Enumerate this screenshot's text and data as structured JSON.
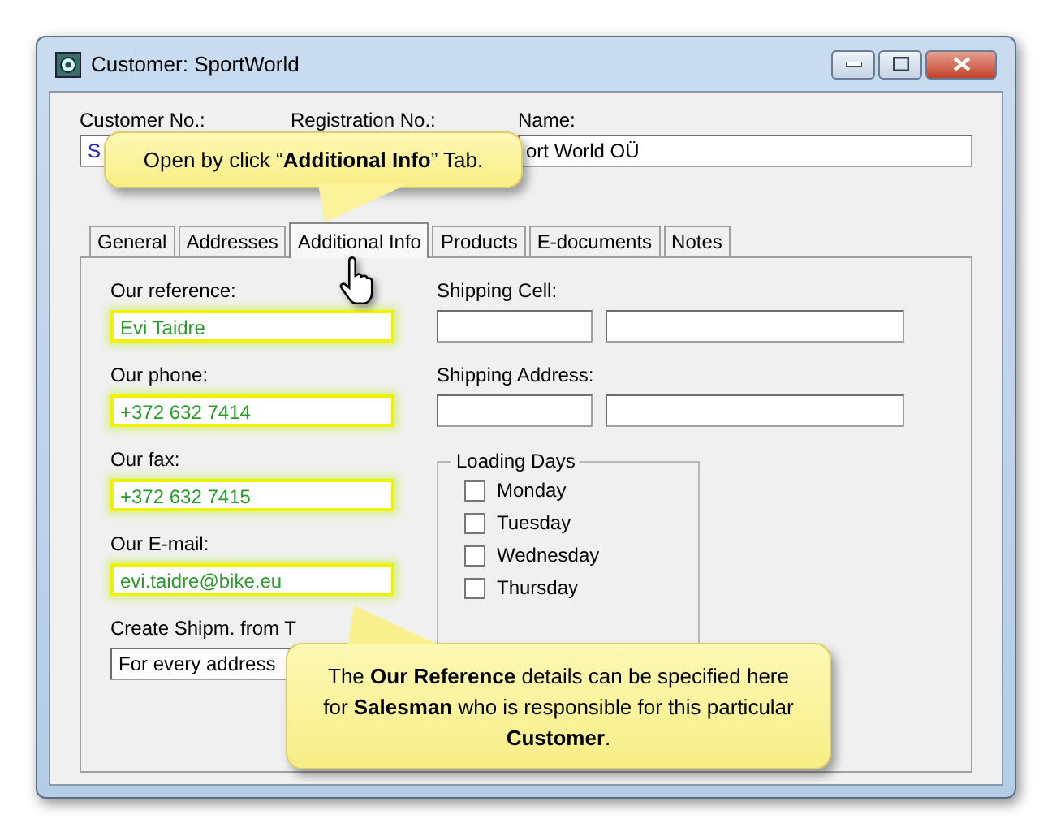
{
  "window": {
    "title": "Customer: SportWorld"
  },
  "header_fields": [
    {
      "label": "Customer No.:",
      "value": "S"
    },
    {
      "label": "Registration No.:"
    },
    {
      "label": "Name:",
      "value": "ort World OÜ"
    }
  ],
  "tabs": [
    {
      "label": "General",
      "selected": false
    },
    {
      "label": "Addresses",
      "selected": false
    },
    {
      "label": "Additional Info",
      "selected": true
    },
    {
      "label": "Products",
      "selected": false
    },
    {
      "label": "E-documents",
      "selected": false
    },
    {
      "label": "Notes",
      "selected": false
    }
  ],
  "our_fields": [
    {
      "label": "Our reference:",
      "value": "Evi Taidre",
      "highlighted": true
    },
    {
      "label": "Our phone:",
      "value": "+372 632 7414",
      "highlighted": true
    },
    {
      "label": "Our fax:",
      "value": "+372 632 7415",
      "highlighted": true
    },
    {
      "label": "Our E-mail:",
      "value": "evi.taidre@bike.eu",
      "highlighted": true
    }
  ],
  "create_shipment": {
    "label": "Create Shipm. from T",
    "value": "For every address"
  },
  "shipping": [
    {
      "label": "Shipping Cell:"
    },
    {
      "label": "Shipping Address:"
    }
  ],
  "loading_days": {
    "title": "Loading Days",
    "days": [
      {
        "label": "Monday",
        "checked": false
      },
      {
        "label": "Tuesday",
        "checked": false
      },
      {
        "label": "Wednesday",
        "checked": false
      },
      {
        "label": "Thursday",
        "checked": false
      }
    ]
  },
  "callouts": [
    {
      "kind": "tail-down",
      "text": "Open by click “**Additional Info**” Tab."
    },
    {
      "kind": "tail-up",
      "text": "The **Our Reference** details can be specified here for **Salesman** who is responsible for this particular **Customer**."
    }
  ]
}
